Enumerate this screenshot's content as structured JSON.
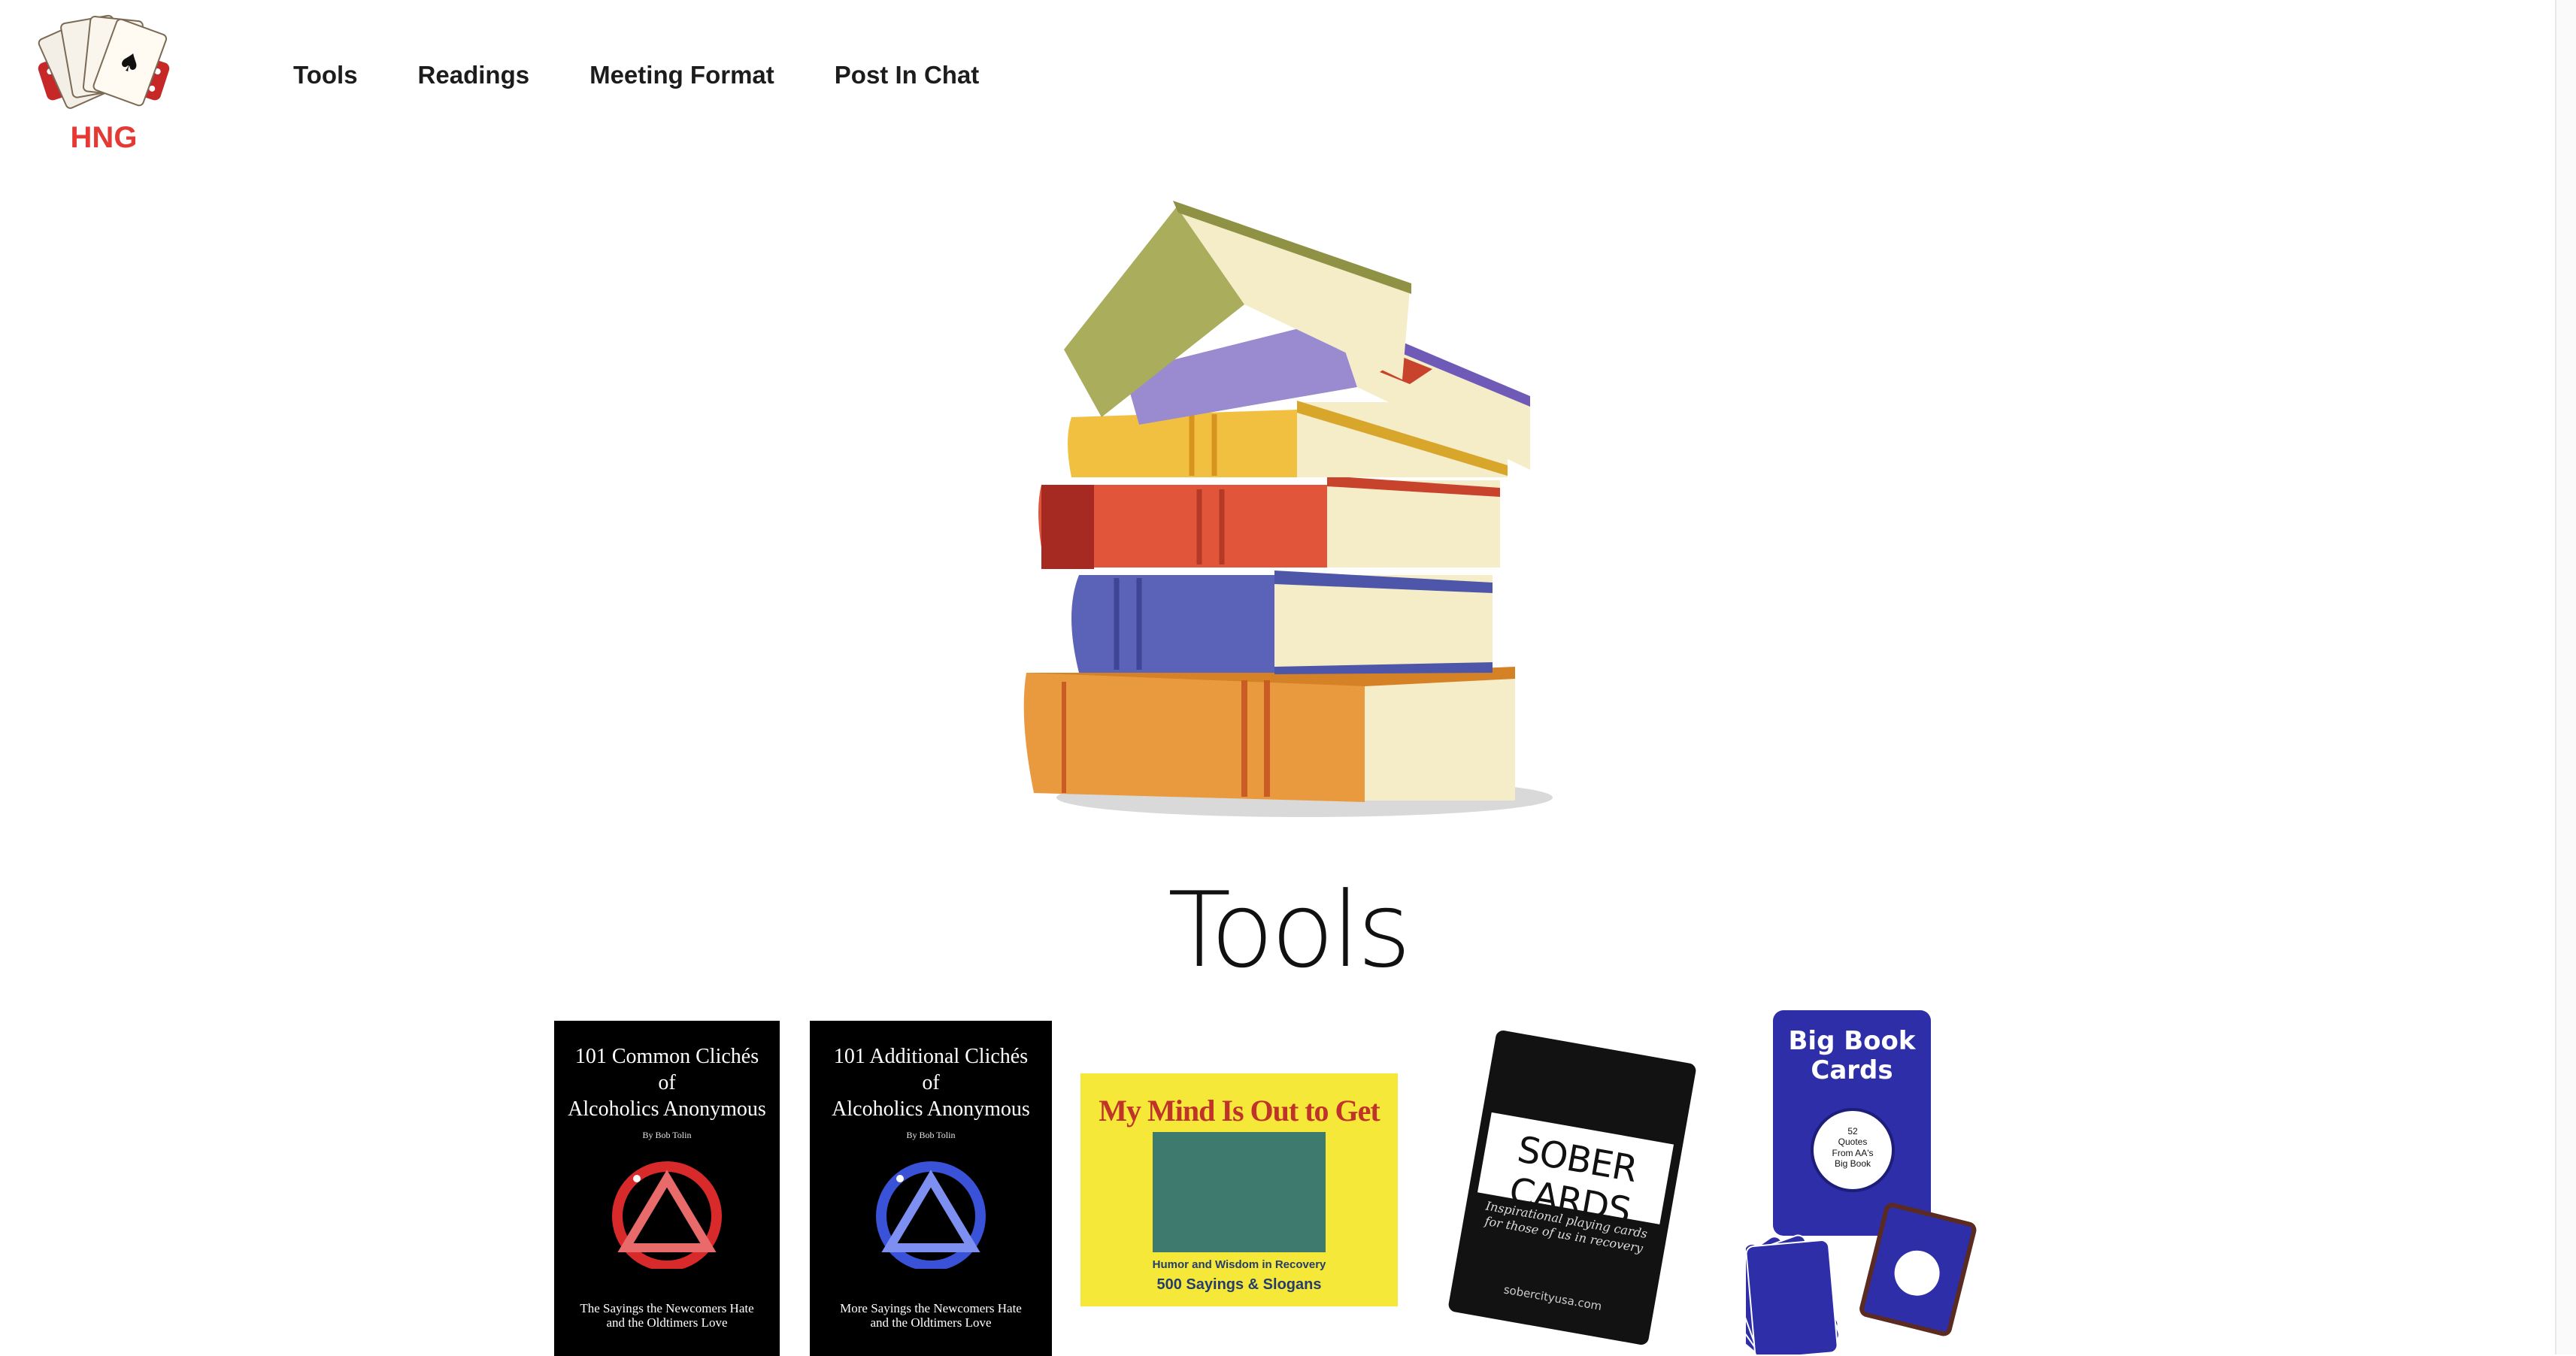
{
  "header": {
    "logo_alt": "HNG",
    "nav": [
      {
        "label": "Tools"
      },
      {
        "label": "Readings"
      },
      {
        "label": "Meeting Format"
      },
      {
        "label": "Post In Chat"
      }
    ]
  },
  "main": {
    "title": "Tools",
    "products": [
      {
        "title_line1": "101 Common Clichés",
        "title_line2": "of",
        "title_line3": "Alcoholics Anonymous",
        "author": "By Bob Tolin",
        "subtitle_line1": "The Sayings the Newcomers Hate",
        "subtitle_line2": "and the Oldtimers Love",
        "accent": "#d82a2a"
      },
      {
        "title_line1": "101 Additional Clichés",
        "title_line2": "of",
        "title_line3": "Alcoholics Anonymous",
        "author": "By Bob Tolin",
        "subtitle_line1": "More Sayings the Newcomers Hate",
        "subtitle_line2": "and the Oldtimers Love",
        "accent": "#3a52d8"
      },
      {
        "title": "My Mind Is Out to Get Me",
        "footer_line1": "Humor and Wisdom in Recovery",
        "footer_line2": "500 Sayings & Slogans"
      },
      {
        "brand": "SOBER CARDS",
        "tagline": "Inspirational playing cards for those of us in recovery",
        "url": "sobercityusa.com"
      },
      {
        "title_line1": "Big Book",
        "title_line2": "Cards",
        "badge_line1": "52",
        "badge_line2": "Quotes",
        "badge_line3": "From AA's",
        "badge_line4": "Big Book"
      }
    ]
  },
  "colors": {
    "nav_text": "#1c1c1c",
    "title_text": "#111111",
    "background": "#ffffff"
  }
}
